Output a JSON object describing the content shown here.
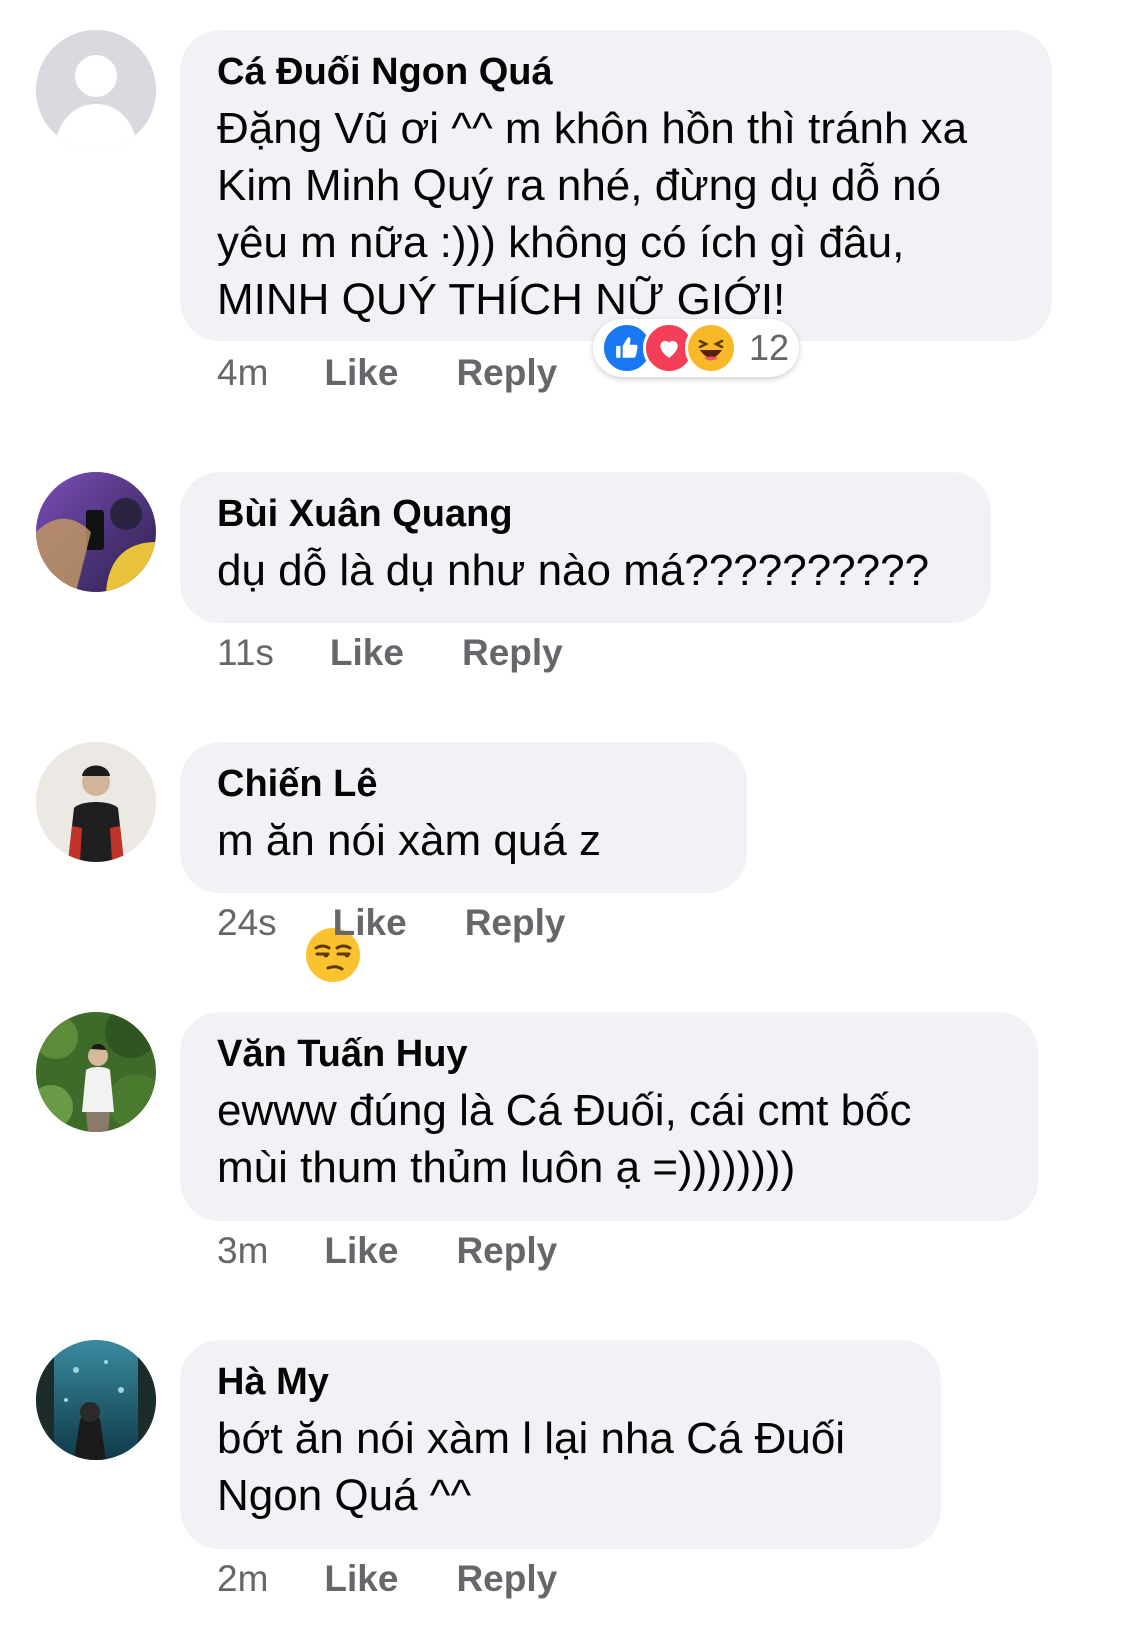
{
  "comments": [
    {
      "author": "Cá Đuối Ngon Quá",
      "text": "Đặng Vũ ơi ^^ m khôn hồn thì tránh xa\nKim Minh Quý ra nhé, đừng dụ dỗ nó\nyêu m nữa :))) không có ích gì đâu,\nMINH QUÝ THÍCH NỮ GIỚI!",
      "time": "4m",
      "like": "Like",
      "reply": "Reply",
      "reaction_count": "12",
      "reactions": [
        "like-icon",
        "love-icon",
        "haha-icon"
      ]
    },
    {
      "author": "Bùi Xuân Quang",
      "text": "dụ dỗ là dụ như nào má??????????",
      "time": "11s",
      "like": "Like",
      "reply": "Reply"
    },
    {
      "author": "Chiến Lê",
      "text": "m ăn nói xàm quá z",
      "emoji": "unamused-face-emoji",
      "time": "24s",
      "like": "Like",
      "reply": "Reply"
    },
    {
      "author": "Văn Tuấn Huy",
      "text": "ewww đúng là Cá Đuối, cái cmt bốc\nmùi thum thủm luôn ạ =))))))))",
      "time": "3m",
      "like": "Like",
      "reply": "Reply"
    },
    {
      "author": "Hà My",
      "text": "bớt ăn nói xàm l lại nha Cá Đuối\nNgon Quá ^^",
      "time": "2m",
      "like": "Like",
      "reply": "Reply"
    }
  ],
  "colors": {
    "bubble": "#f0f2f5",
    "meta": "#65676b",
    "like_blue": "#1877f2",
    "love_red": "#f33e58",
    "haha_yellow": "#f7b928"
  }
}
